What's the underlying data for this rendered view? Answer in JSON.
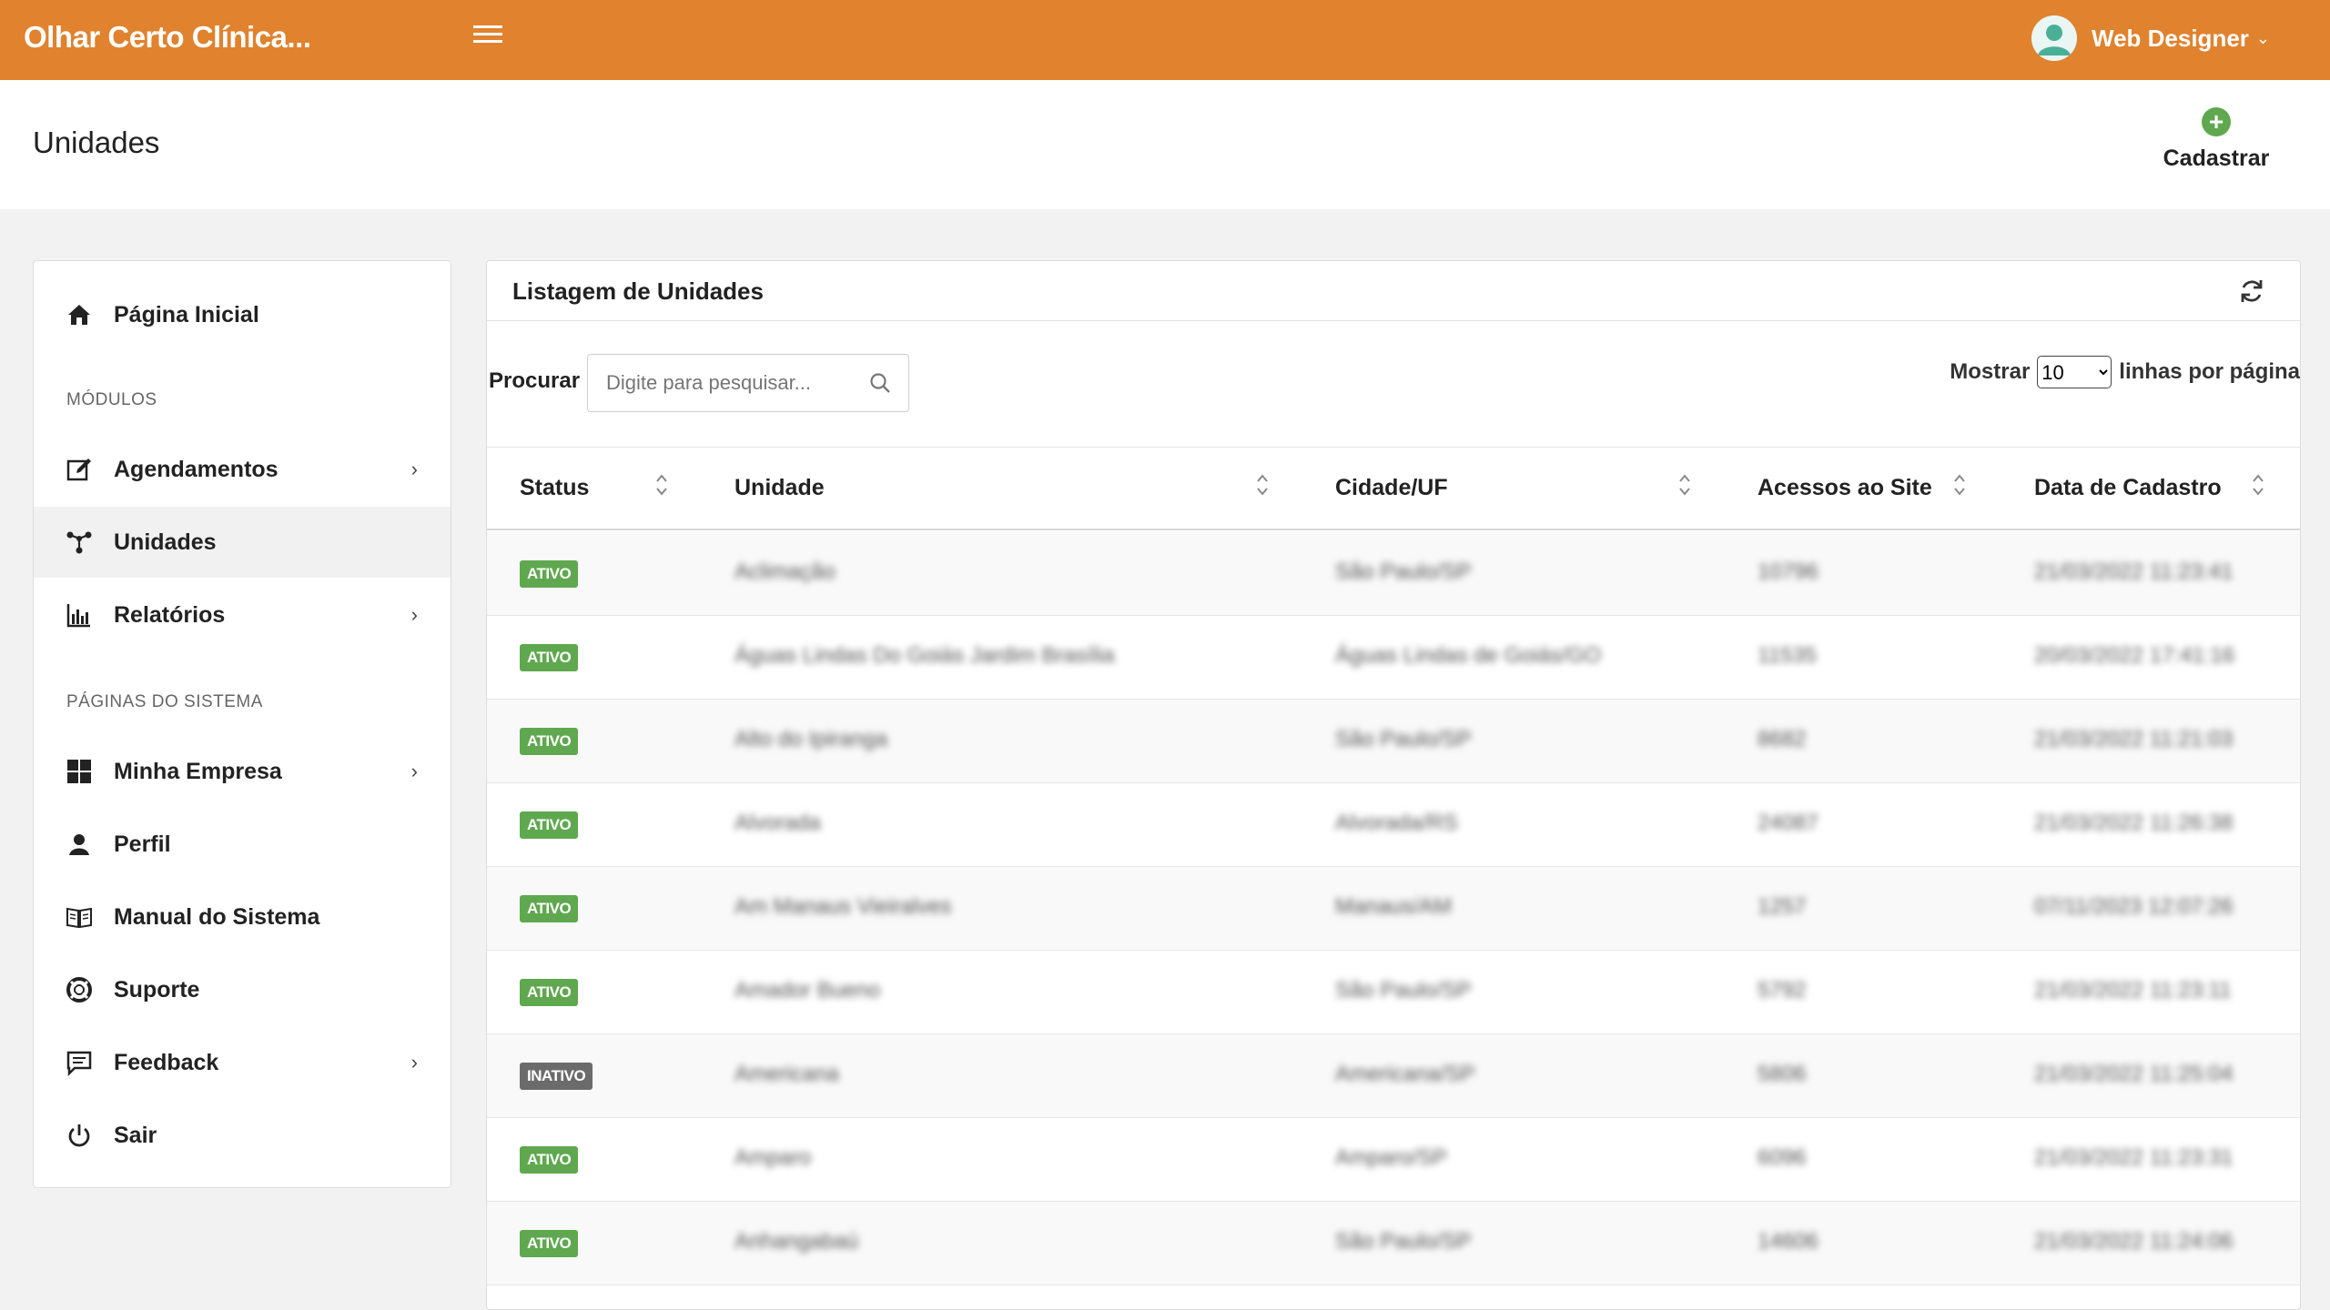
{
  "app": {
    "title": "Olhar Certo Clínica...",
    "user": "Web Designer"
  },
  "header": {
    "page_title": "Unidades",
    "add_label": "Cadastrar"
  },
  "sidebar": {
    "home": "Página Inicial",
    "section_modules": "MÓDULOS",
    "items_modules": [
      "Agendamentos",
      "Unidades",
      "Relatórios"
    ],
    "section_system": "PÁGINAS DO SISTEMA",
    "items_system": [
      "Minha Empresa",
      "Perfil",
      "Manual do Sistema",
      "Suporte",
      "Feedback",
      "Sair"
    ]
  },
  "panel": {
    "title": "Listagem de Unidades",
    "search_label": "Procurar",
    "search_placeholder": "Digite para pesquisar...",
    "show_label": "Mostrar",
    "page_size": "10",
    "page_size_suffix": "linhas por página",
    "columns": [
      "Status",
      "Unidade",
      "Cidade/UF",
      "Acessos ao Site",
      "Data de Cadastro"
    ]
  },
  "rows": [
    {
      "status": "ATIVO",
      "active": true,
      "unit": "Aclimação",
      "city": "São Paulo/SP",
      "visits": "10796",
      "date": "21/03/2022 11:23:41"
    },
    {
      "status": "ATIVO",
      "active": true,
      "unit": "Águas Lindas Do Goiás Jardim Brasília",
      "city": "Águas Lindas de Goiás/GO",
      "visits": "11535",
      "date": "20/03/2022 17:41:16"
    },
    {
      "status": "ATIVO",
      "active": true,
      "unit": "Alto do Ipiranga",
      "city": "São Paulo/SP",
      "visits": "8682",
      "date": "21/03/2022 11:21:03"
    },
    {
      "status": "ATIVO",
      "active": true,
      "unit": "Alvorada",
      "city": "Alvorada/RS",
      "visits": "24087",
      "date": "21/03/2022 11:26:38"
    },
    {
      "status": "ATIVO",
      "active": true,
      "unit": "Am Manaus Vieiralves",
      "city": "Manaus/AM",
      "visits": "1257",
      "date": "07/11/2023 12:07:26"
    },
    {
      "status": "ATIVO",
      "active": true,
      "unit": "Amador Bueno",
      "city": "São Paulo/SP",
      "visits": "5792",
      "date": "21/03/2022 11:23:11"
    },
    {
      "status": "INATIVO",
      "active": false,
      "unit": "Americana",
      "city": "Americana/SP",
      "visits": "5806",
      "date": "21/03/2022 11:25:04"
    },
    {
      "status": "ATIVO",
      "active": true,
      "unit": "Amparo",
      "city": "Amparo/SP",
      "visits": "6096",
      "date": "21/03/2022 11:23:31"
    },
    {
      "status": "ATIVO",
      "active": true,
      "unit": "Anhangabaú",
      "city": "São Paulo/SP",
      "visits": "14606",
      "date": "21/03/2022 11:24:06"
    }
  ],
  "colors": {
    "brand": "#e0822e",
    "active_badge": "#5fa84f",
    "inactive_badge": "#6b6b6b"
  },
  "icons": [
    "menu-icon",
    "user-avatar-icon",
    "plus-circle-icon",
    "home-icon",
    "edit-icon",
    "network-icon",
    "bar-chart-icon",
    "grid-icon",
    "person-icon",
    "book-icon",
    "lifebuoy-icon",
    "comment-icon",
    "power-icon",
    "refresh-icon",
    "search-icon",
    "sort-icon",
    "chevron-right-icon"
  ]
}
